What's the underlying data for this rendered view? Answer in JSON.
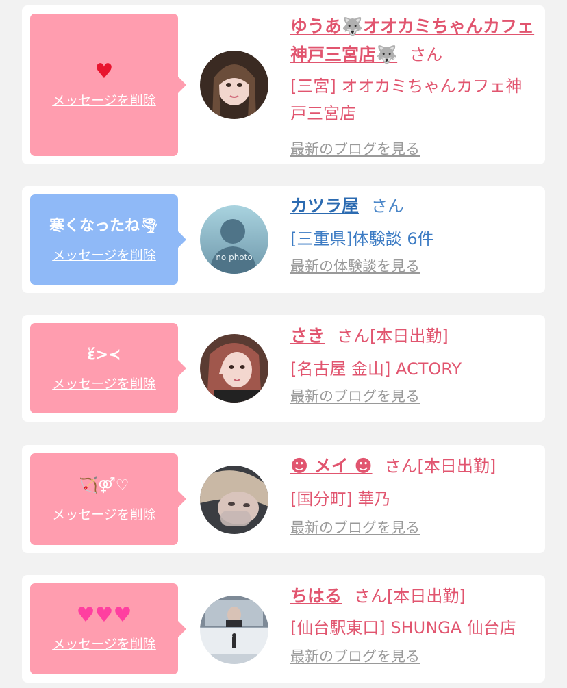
{
  "delete_label": "メッセージを削除",
  "suffix": "さん",
  "cards": [
    {
      "message": "♥",
      "name": "ゆうあ🐺オオカミちゃんカフェ神戸三宮店🐺",
      "extra": "",
      "location": "[三宮] オオカミちゃんカフェ神戸三宮店",
      "latest": "最新のブログを見る"
    },
    {
      "message": "寒くなったね🌪",
      "name": "カツラ屋",
      "extra": "",
      "location": "[三重県]体験談 6件",
      "latest": "最新の体験談を見る",
      "avatar_text": "no photo"
    },
    {
      "message": "ἕ>≺",
      "name": "さき",
      "extra": "[本日出勤]",
      "location": "[名古屋 金山] ACTORY",
      "latest": "最新のブログを見る"
    },
    {
      "message": "🏹⚤♡",
      "name": "☻ メイ ☻",
      "extra": "[本日出勤]",
      "location": "[国分町] 華乃",
      "latest": "最新のブログを見る"
    },
    {
      "message": "♥♥♥",
      "name": "ちはる",
      "extra": "[本日出勤]",
      "location": "[仙台駅東口] SHUNGA 仙台店",
      "latest": "最新のブログを見る"
    }
  ],
  "colors": {
    "bubble_pink": "#ff9daf",
    "bubble_blue": "#8fb9f7",
    "name_pink": "#e1556f",
    "name_blue": "#2c6bb1",
    "link_gray": "#9a9a9a",
    "background": "#f2f2f2"
  }
}
